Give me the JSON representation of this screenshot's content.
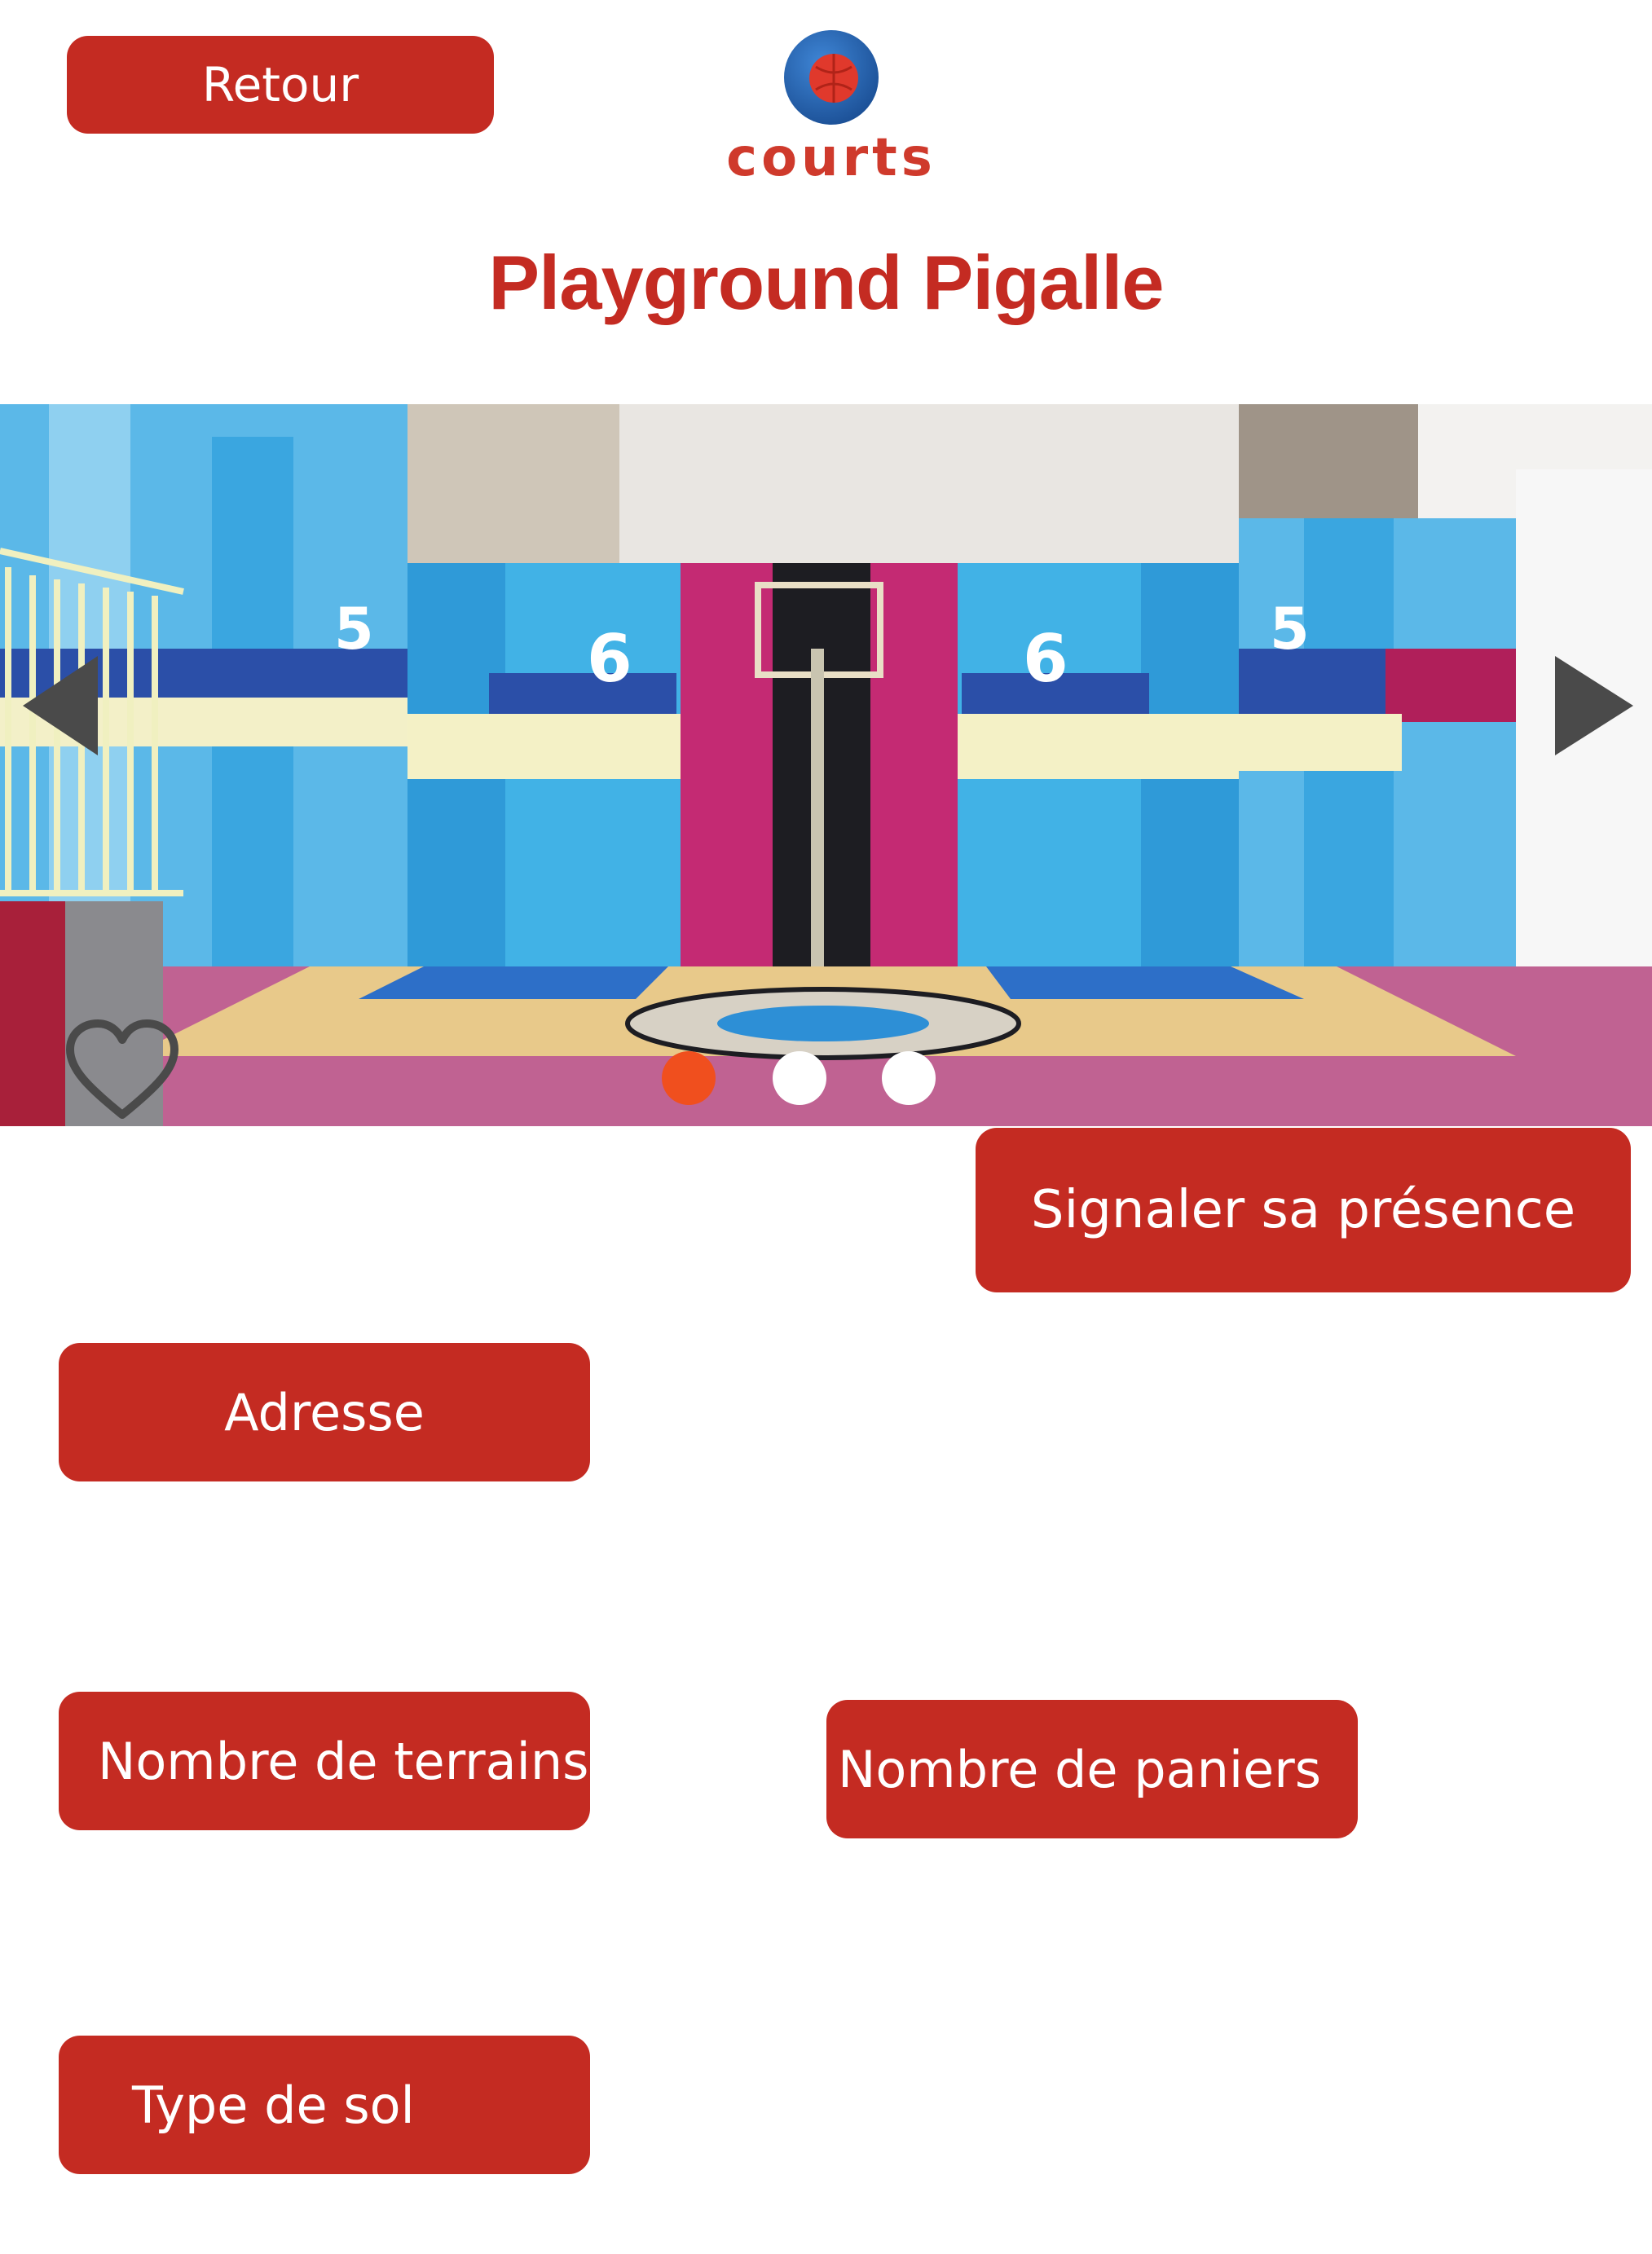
{
  "header": {
    "back_label": "Retour",
    "logo_text": "courts",
    "logo_icon": "basketball-icon"
  },
  "page": {
    "title": "Playground Pigalle"
  },
  "carousel": {
    "image": "basketball-court-photo",
    "prev_icon": "chevron-left-icon",
    "next_icon": "chevron-right-icon",
    "favorite_icon": "heart-outline-icon",
    "slide_count": 3,
    "active_slide": 1,
    "active_dot_color": "#f04f1e"
  },
  "actions": {
    "presence_label": "Signaler sa présence"
  },
  "info": {
    "adresse_label": "Adresse",
    "terrains_label": "Nombre de terrains",
    "paniers_label": "Nombre de paniers",
    "sol_label": "Type de sol"
  },
  "colors": {
    "accent": "#c42b22",
    "logo_text": "#cf3a2c",
    "background": "#ffffff"
  }
}
